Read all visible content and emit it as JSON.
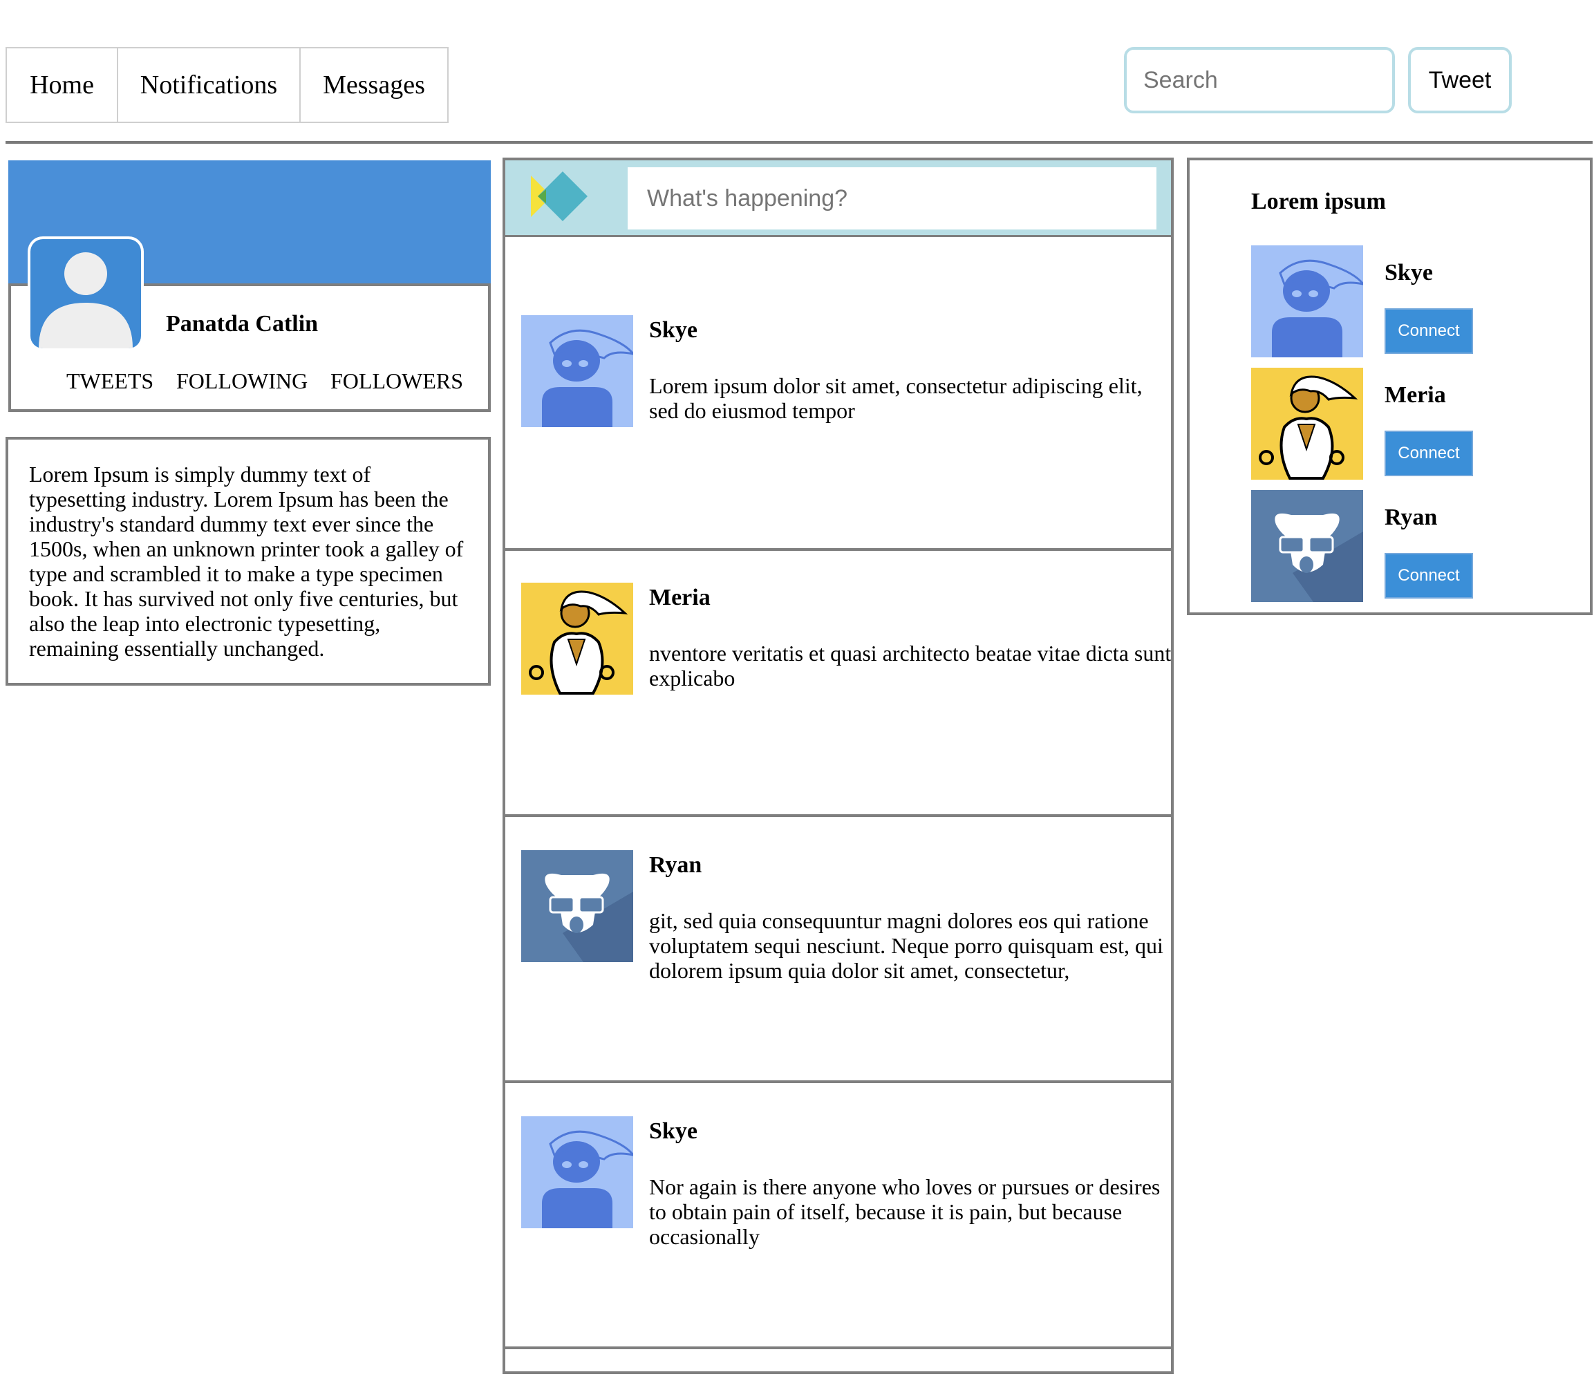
{
  "nav": {
    "tabs": [
      {
        "label": "Home"
      },
      {
        "label": "Notifications"
      },
      {
        "label": "Messages"
      }
    ],
    "search_placeholder": "Search",
    "tweet_label": "Tweet"
  },
  "profile": {
    "name": "Panatda Catlin",
    "stats": [
      "TWEETS",
      "FOLLOWING",
      "FOLLOWERS"
    ],
    "bio": "Lorem Ipsum is simply dummy text of typesetting industry. Lorem Ipsum has been the industry's standard dummy text ever since the 1500s, when an unknown printer took a galley of type and scrambled it to make a type specimen book. It has survived not only five centuries, but also the leap into electronic typesetting, remaining essentially unchanged."
  },
  "compose": {
    "placeholder": "What's happening?"
  },
  "feed": [
    {
      "name": "Skye",
      "text": "Lorem ipsum dolor sit amet, consectetur adipiscing elit, sed do eiusmod tempor",
      "avatar": "skye-avatar"
    },
    {
      "name": "Meria",
      "text": "nventore veritatis et quasi architecto beatae vitae dicta sunt explicabo",
      "avatar": "meria-avatar"
    },
    {
      "name": "Ryan",
      "text": "git, sed quia consequuntur magni dolores eos qui ratione voluptatem sequi nesciunt. Neque porro quisquam est, qui dolorem ipsum quia dolor sit amet, consectetur,",
      "avatar": "ryan-avatar"
    },
    {
      "name": "Skye",
      "text": "Nor again is there anyone who loves or pursues or desires to obtain pain of itself, because it is pain, but because occasionally",
      "avatar": "skye-avatar"
    }
  ],
  "suggestions": {
    "title": "Lorem ipsum",
    "connect_label": "Connect",
    "people": [
      {
        "name": "Skye",
        "avatar": "skye-avatar"
      },
      {
        "name": "Meria",
        "avatar": "meria-avatar"
      },
      {
        "name": "Ryan",
        "avatar": "ryan-avatar"
      }
    ]
  },
  "colors": {
    "cover": "#4a8fd8",
    "compose_bar": "#b9dfe6",
    "input_border": "#b8dde6",
    "connect_button": "#3b8fd8",
    "skye_bg": "#a3c1f7",
    "meria_bg": "#f6cf48",
    "ryan_bg": "#5a7ea9"
  }
}
